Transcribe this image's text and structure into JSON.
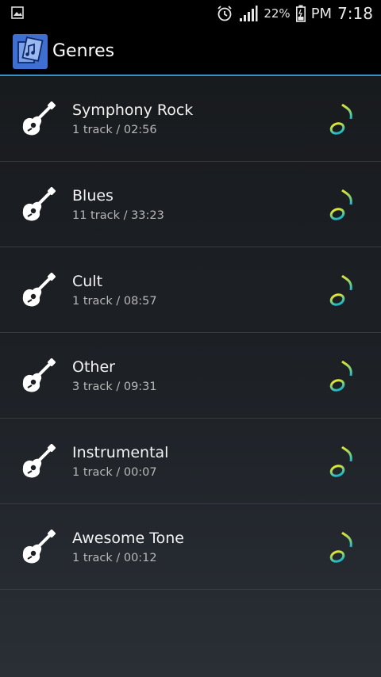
{
  "status_bar": {
    "battery_percent": "22%",
    "am_pm": "PM",
    "time": "7:18",
    "icons": [
      "image-icon",
      "alarm-icon",
      "signal-icon",
      "battery-icon"
    ]
  },
  "action_bar": {
    "title": "Genres",
    "icon": "music-cards-icon",
    "accent_color": "#3b8fc9"
  },
  "genres": [
    {
      "name": "Symphony Rock",
      "meta": "1 track / 02:56"
    },
    {
      "name": "Blues",
      "meta": "11 track / 33:23"
    },
    {
      "name": "Cult",
      "meta": "1 track / 08:57"
    },
    {
      "name": "Other",
      "meta": "3 track / 09:31"
    },
    {
      "name": "Instrumental",
      "meta": "1 track / 00:07"
    },
    {
      "name": "Awesome Tone",
      "meta": "1 track / 00:12"
    }
  ],
  "row_icons": {
    "left": "guitar-icon",
    "right": "music-note-icon"
  }
}
